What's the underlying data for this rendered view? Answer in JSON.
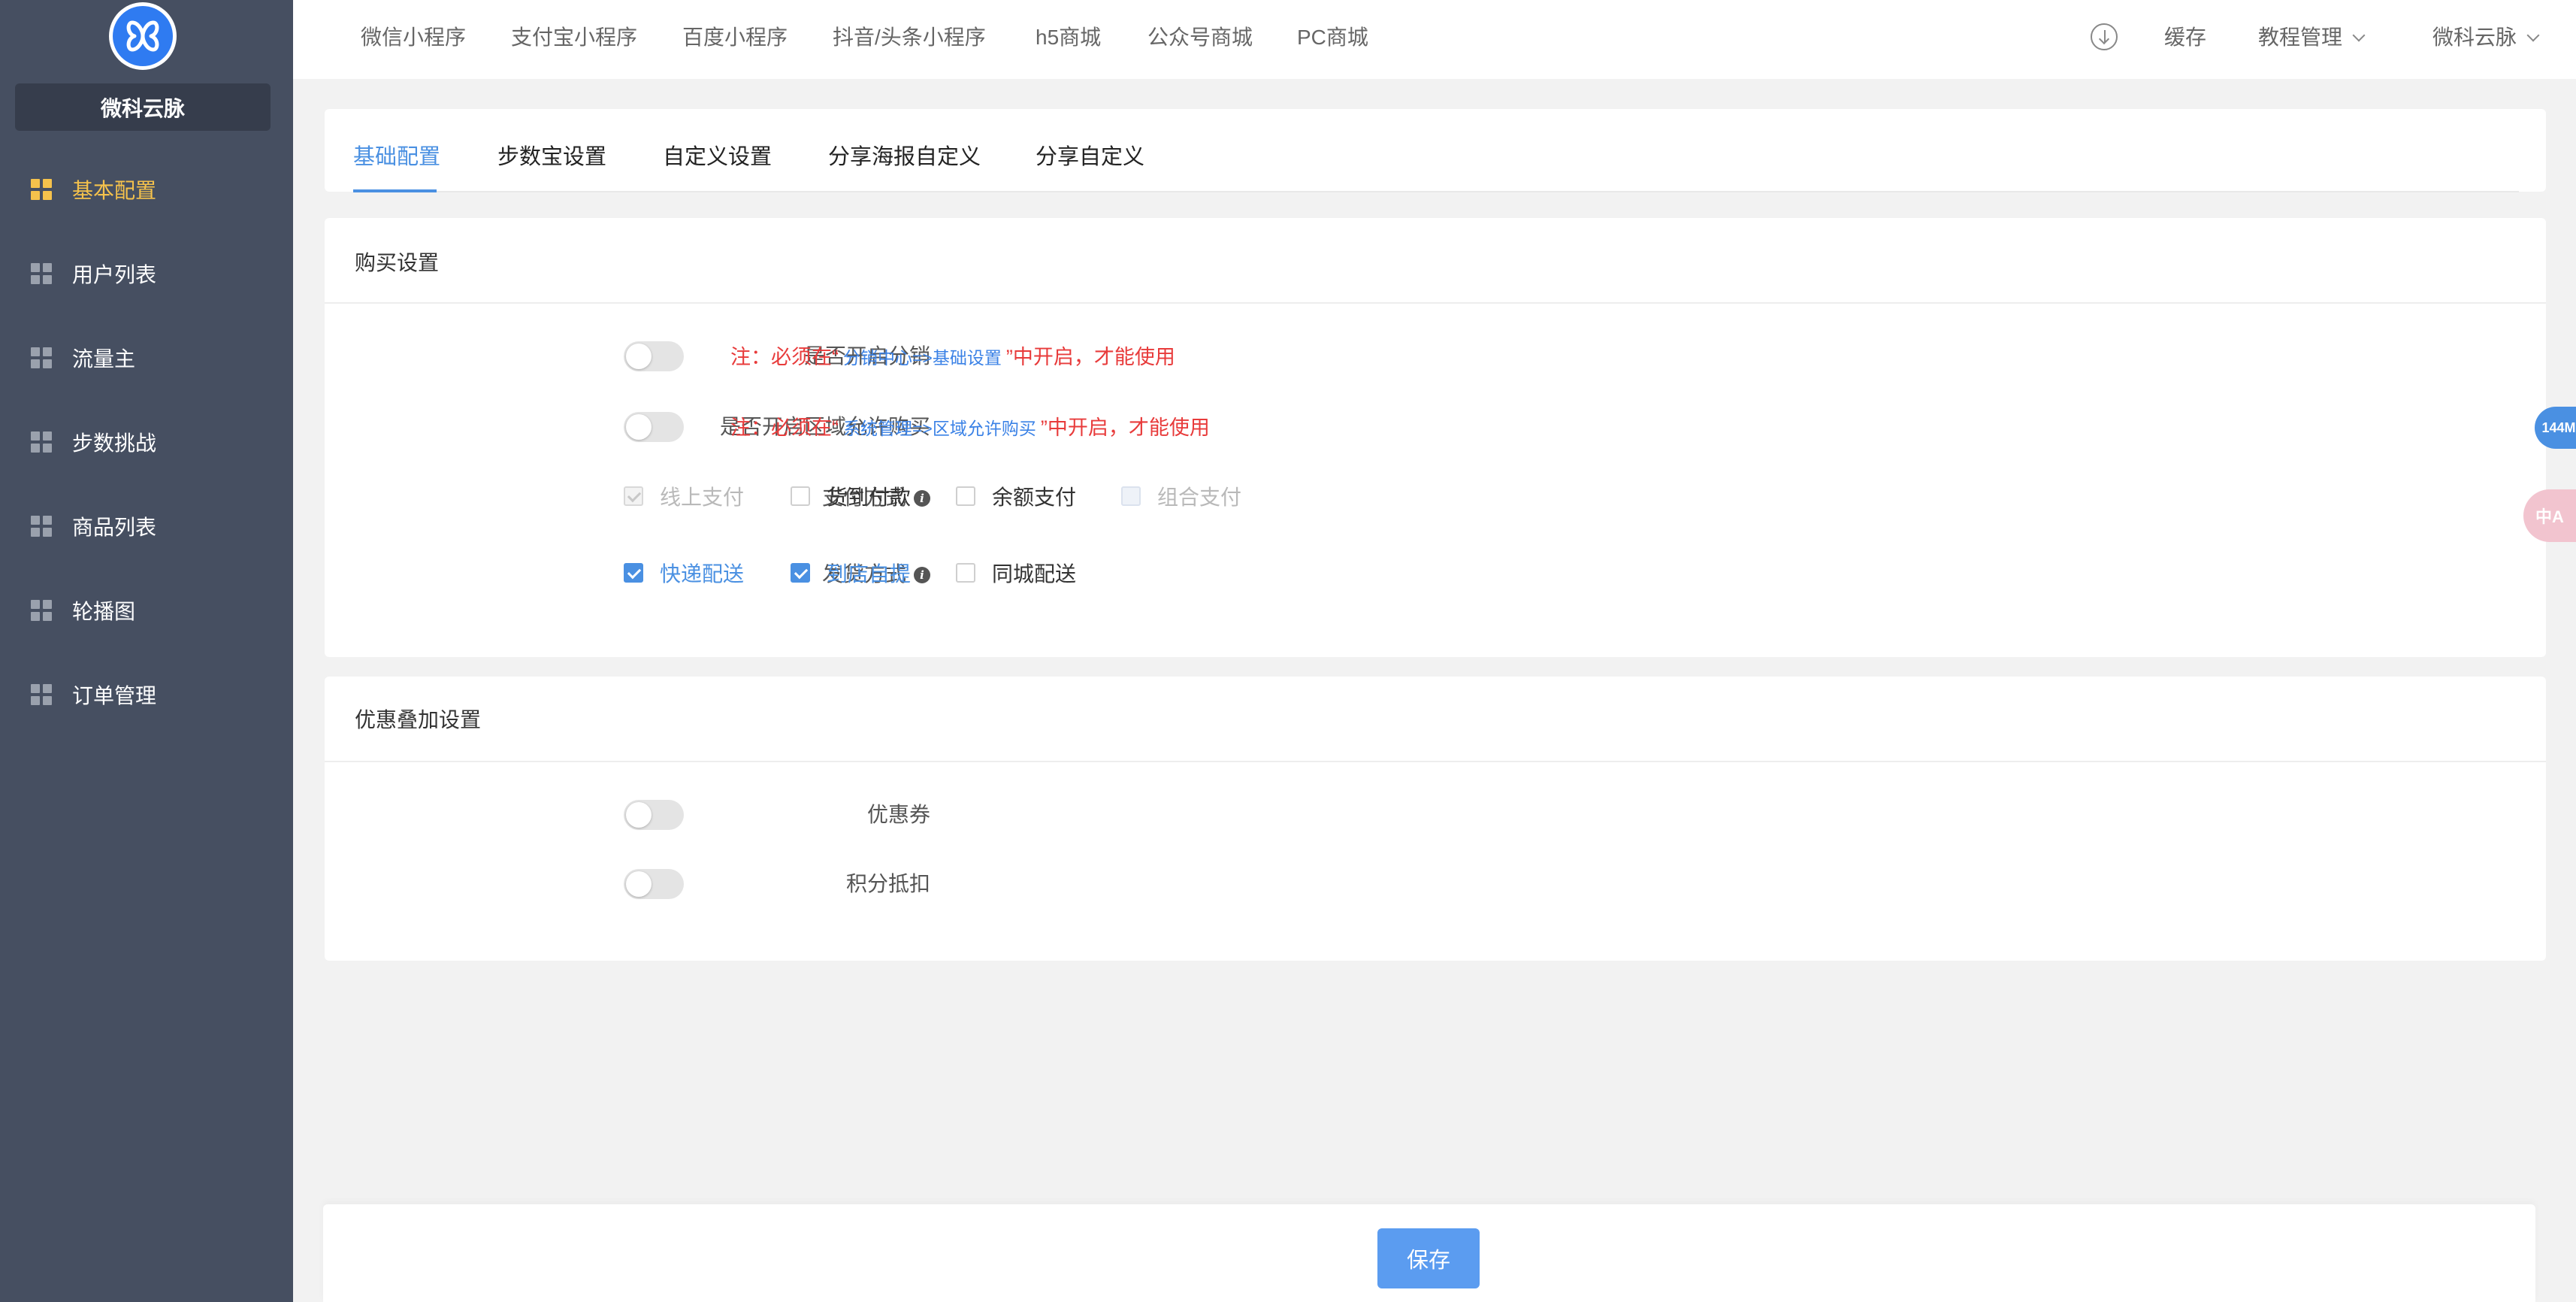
{
  "sidebar": {
    "brand": "微科云脉",
    "items": [
      {
        "label": "基本配置",
        "active": true
      },
      {
        "label": "用户列表"
      },
      {
        "label": "流量主"
      },
      {
        "label": "步数挑战"
      },
      {
        "label": "商品列表"
      },
      {
        "label": "轮播图"
      },
      {
        "label": "订单管理"
      }
    ]
  },
  "header": {
    "tabs": [
      "微信小程序",
      "支付宝小程序",
      "百度小程序",
      "抖音/头条小程序",
      "h5商城",
      "公众号商城",
      "PC商城"
    ],
    "cache_label": "缓存",
    "tutorial_label": "教程管理",
    "user_label": "微科云脉"
  },
  "config_tabs": [
    "基础配置",
    "步数宝设置",
    "自定义设置",
    "分享海报自定义",
    "分享自定义"
  ],
  "purchase": {
    "title": "购买设置",
    "distribution": {
      "label": "是否开启分销",
      "note_prefix": "注：必须在“",
      "note_link": "分销中心=>基础设置",
      "note_suffix": "”中开启，才能使用"
    },
    "region": {
      "label": "是否开启区域允许购买",
      "note_prefix": "注：必须在“",
      "note_link": "系统管理=>区域允许购买",
      "note_suffix": "”中开启，才能使用"
    },
    "payment": {
      "label": "支付方式",
      "options": [
        "线上支付",
        "货到付款",
        "余额支付",
        "组合支付"
      ]
    },
    "delivery": {
      "label": "发货方式",
      "options": [
        "快递配送",
        "到店自提",
        "同城配送"
      ]
    }
  },
  "discount": {
    "title": "优惠叠加设置",
    "coupon_label": "优惠券",
    "points_label": "积分抵扣"
  },
  "floating": {
    "memory": "144M",
    "translate": "中A"
  },
  "footer": {
    "save_label": "保存"
  },
  "colors": {
    "sidebar_bg": "#464f61",
    "accent": "#4a90e2",
    "active_nav": "#f5c24c",
    "warning": "#e83b3b"
  }
}
